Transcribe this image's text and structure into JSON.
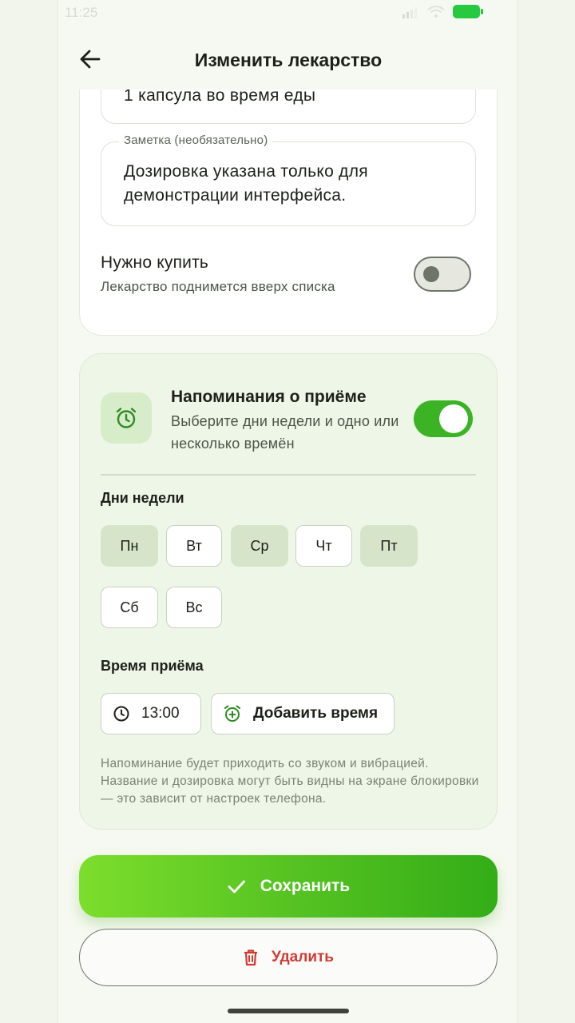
{
  "status": {
    "time": "11:25"
  },
  "header": {
    "title": "Изменить лекарство"
  },
  "form": {
    "dose_value": "1 капсула во время еды",
    "note_label": "Заметка (необязательно)",
    "note_value": "Дозировка указана только для демонстрации интерфейса.",
    "buy_title": "Нужно купить",
    "buy_subtitle": "Лекарство поднимется вверх списка",
    "buy_toggle": false
  },
  "reminders": {
    "title": "Напоминания о приёме",
    "subtitle": "Выберите дни недели и одно или несколько времён",
    "enabled": true,
    "days_label": "Дни недели",
    "days": [
      {
        "label": "Пн",
        "selected": true
      },
      {
        "label": "Вт",
        "selected": false
      },
      {
        "label": "Ср",
        "selected": true
      },
      {
        "label": "Чт",
        "selected": false
      },
      {
        "label": "Пт",
        "selected": true
      },
      {
        "label": "Сб",
        "selected": false
      },
      {
        "label": "Вс",
        "selected": false
      }
    ],
    "time_label": "Время приёма",
    "times": [
      "13:00"
    ],
    "add_time_label": "Добавить время",
    "hint": "Напоминание будет приходить со звуком и вибрацией. Название и дозировка могут быть видны на экране блокировки — это зависит от настроек телефона."
  },
  "actions": {
    "save_label": "Сохранить",
    "delete_label": "Удалить"
  },
  "colors": {
    "accent": "#3bb324",
    "danger": "#d23a31",
    "selected_day": "#d6e5c9"
  }
}
